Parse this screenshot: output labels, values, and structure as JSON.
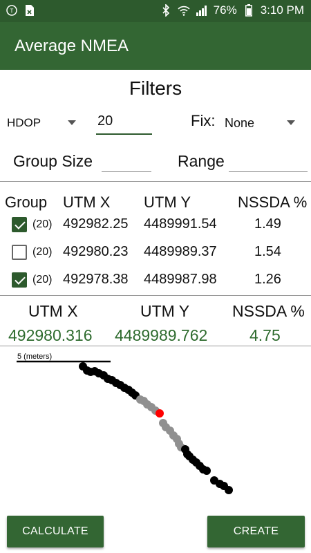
{
  "status_bar": {
    "battery": "76%",
    "time": "3:10 PM"
  },
  "app_bar": {
    "title": "Average NMEA"
  },
  "filters": {
    "title": "Filters",
    "hdop_label": "HDOP",
    "hdop_value": "20",
    "fix_label": "Fix:",
    "fix_value": "None",
    "group_size_label": "Group Size",
    "group_size_value": "",
    "range_label": "Range",
    "range_value": ""
  },
  "table": {
    "headers": [
      "Group",
      "UTM X",
      "UTM Y",
      "NSSDA %"
    ],
    "rows": [
      {
        "checked": true,
        "count": "(20)",
        "utm_x": "492982.25",
        "utm_y": "4489991.54",
        "nssda": "1.49"
      },
      {
        "checked": false,
        "count": "(20)",
        "utm_x": "492980.23",
        "utm_y": "4489989.37",
        "nssda": "1.54"
      },
      {
        "checked": true,
        "count": "(20)",
        "utm_x": "492978.38",
        "utm_y": "4489987.98",
        "nssda": "1.26"
      }
    ]
  },
  "summary": {
    "headers": [
      "UTM X",
      "UTM Y",
      "NSSDA %"
    ],
    "utm_x": "492980.316",
    "utm_y": "4489989.762",
    "nssda": "4.75"
  },
  "plot": {
    "scale_label": "5 (meters)",
    "colors": {
      "selected": "#000000",
      "unselected": "#909090",
      "average": "#ff0000"
    }
  },
  "buttons": {
    "calculate": "CALCULATE",
    "create": "CREATE"
  },
  "colors": {
    "primary": "#336633",
    "status_bar": "#2d5a2d",
    "value_text": "#2e6b2e"
  }
}
